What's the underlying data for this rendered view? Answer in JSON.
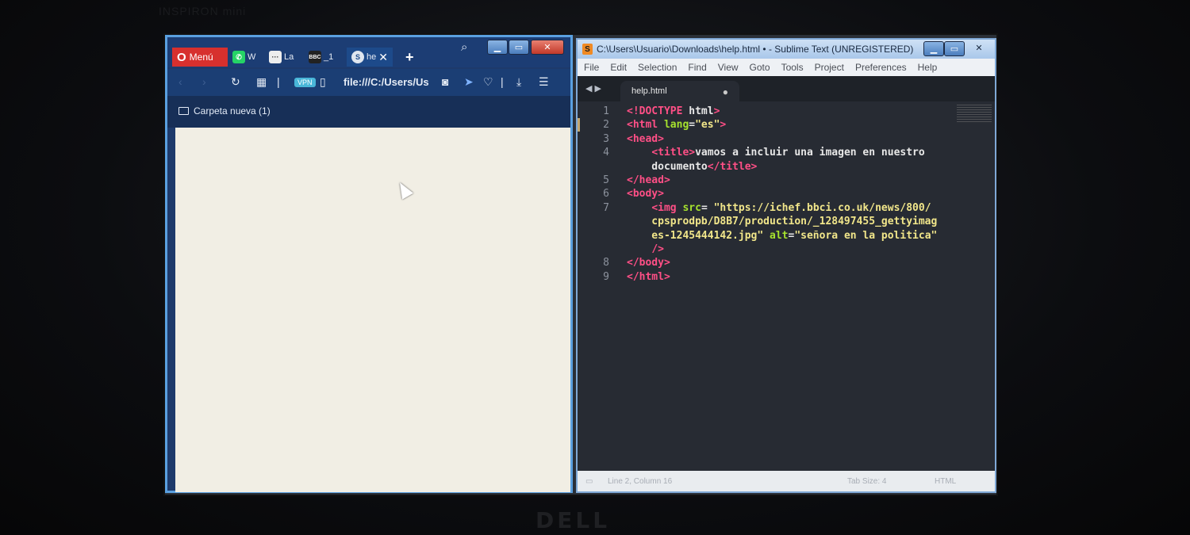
{
  "browser": {
    "menu_label": "Menú",
    "tabs": [
      {
        "label": "W",
        "icon": "whatsapp-icon",
        "color": "#25d366"
      },
      {
        "label": "La",
        "icon": "chat-icon",
        "color": "#eeeeee"
      },
      {
        "label": "_1",
        "icon": "bbc-icon",
        "color": "#ffffff"
      },
      {
        "label": "he",
        "icon": "file-icon",
        "color": "#ffffff",
        "active": true
      }
    ],
    "address": "file:///C:/Users/Us",
    "vpn_label": "VPN",
    "bookmark": "Carpeta nueva (1)"
  },
  "sublime": {
    "title": "C:\\Users\\Usuario\\Downloads\\help.html • - Sublime Text (UNREGISTERED)",
    "menu": [
      "File",
      "Edit",
      "Selection",
      "Find",
      "View",
      "Goto",
      "Tools",
      "Project",
      "Preferences",
      "Help"
    ],
    "tab": "help.html",
    "line_numbers": [
      "1",
      "2",
      "3",
      "4",
      "",
      "5",
      "6",
      "7",
      "",
      "",
      "",
      "8",
      "9"
    ],
    "status": {
      "position": "Line 2, Column 16",
      "tab_size": "Tab Size: 4",
      "syntax": "HTML"
    }
  }
}
